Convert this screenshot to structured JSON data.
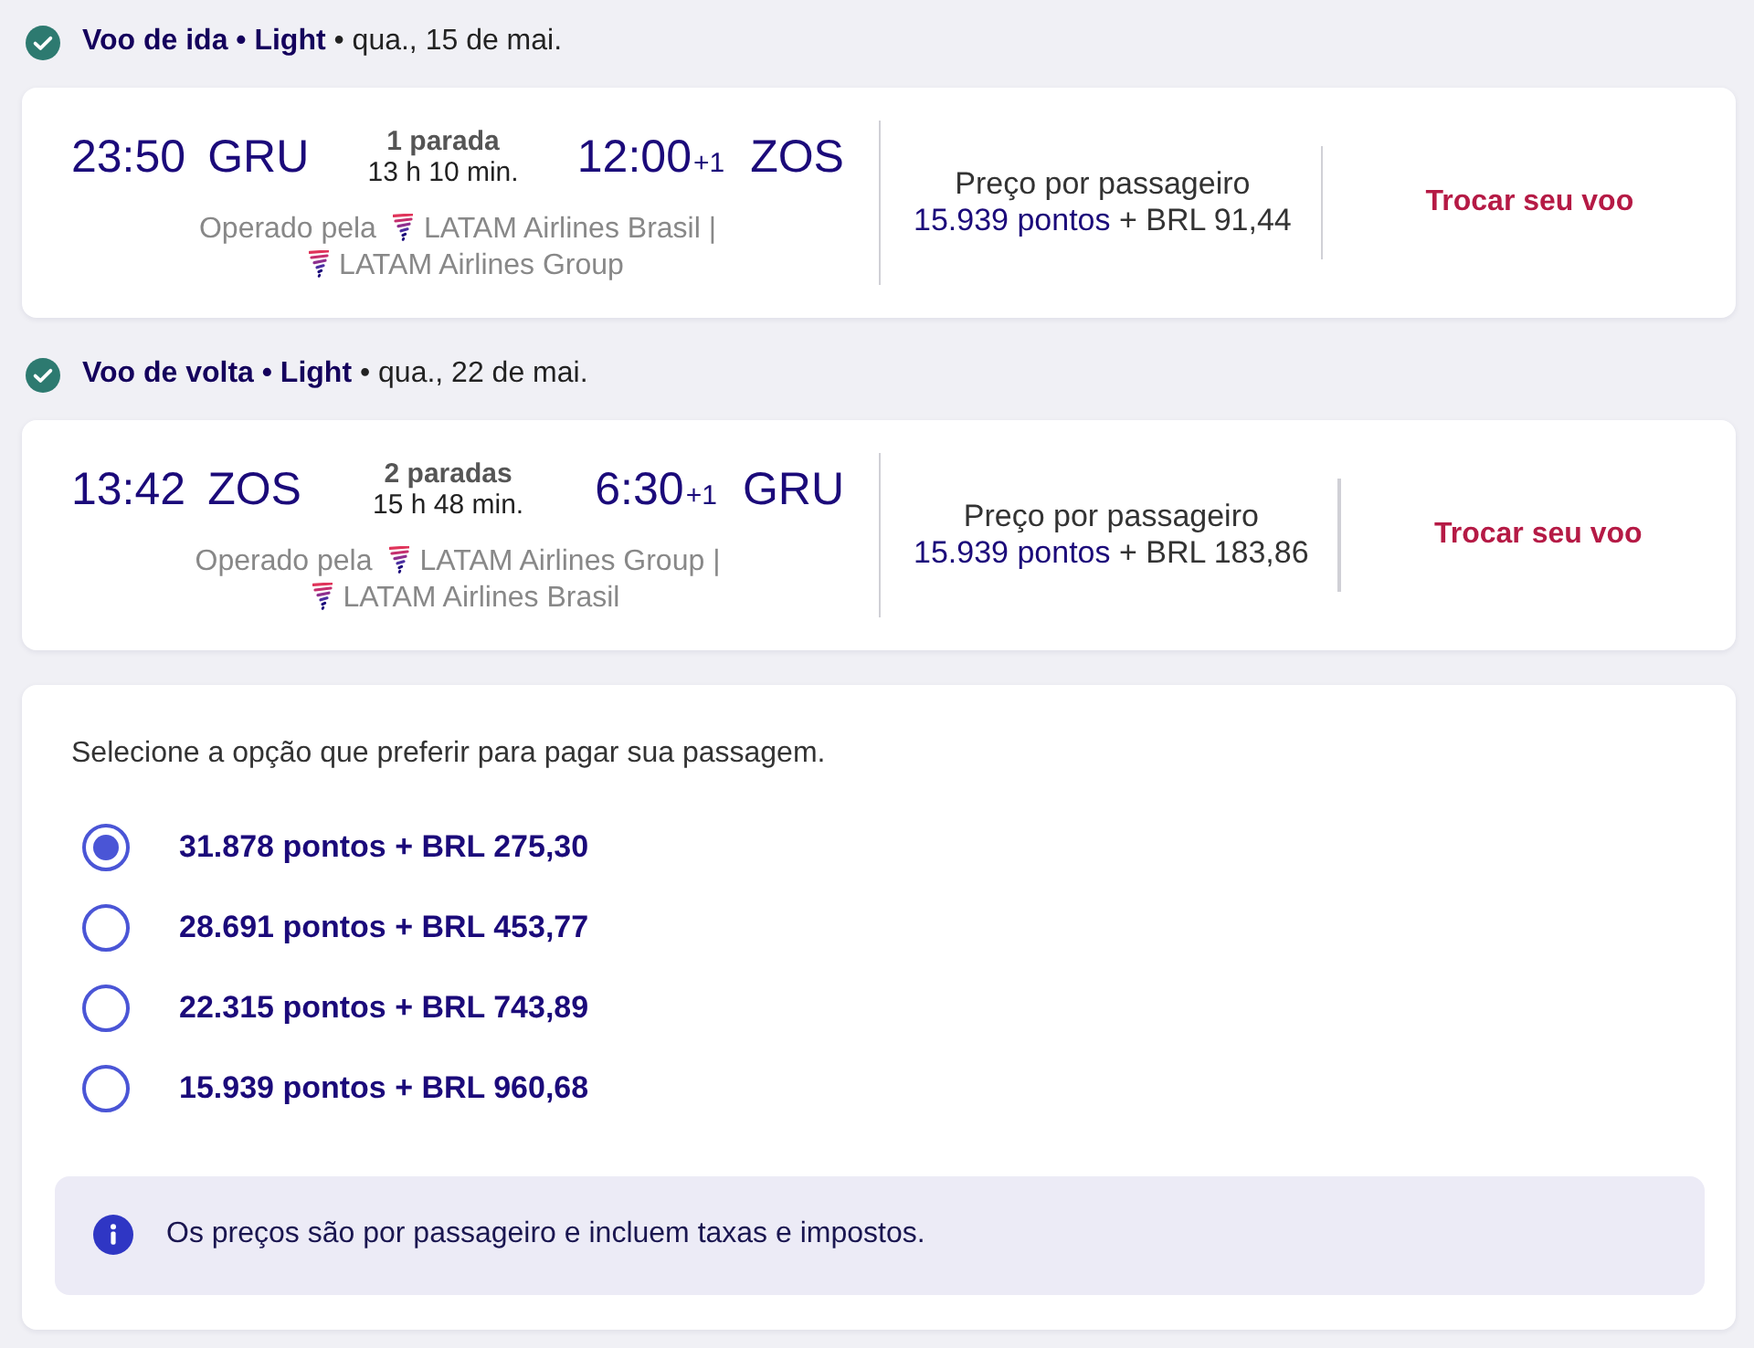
{
  "segments": [
    {
      "header": "**Voo de ida • Light** • qua., 15 de mai.",
      "departure": {
        "time": "23:50",
        "airport": "GRU"
      },
      "stops": "1 parada",
      "duration": "13 h 10 min.",
      "arrival": {
        "time": "12:00",
        "day_offset": "+1",
        "airport": "ZOS"
      },
      "operated_by": {
        "label": "Operado pela",
        "separator": "|",
        "carriers": [
          {
            "name": "LATAM Airlines Brasil"
          },
          {
            "name": "LATAM Airlines Group"
          }
        ]
      },
      "price": {
        "label": "Preço por passageiro",
        "points": "15.939 pontos",
        "cash": "+ BRL 91,44"
      },
      "change_button": "Trocar seu voo"
    },
    {
      "header": "**Voo de volta • Light** • qua., 22 de mai.",
      "departure": {
        "time": "13:42",
        "airport": "ZOS"
      },
      "stops": "2 paradas",
      "duration": "15 h 48 min.",
      "arrival": {
        "time": "6:30",
        "day_offset": "+1",
        "airport": "GRU"
      },
      "operated_by": {
        "label": "Operado pela",
        "separator": "|",
        "carriers": [
          {
            "name": "LATAM Airlines Group"
          },
          {
            "name": "LATAM Airlines Brasil"
          }
        ]
      },
      "price": {
        "label": "Preço por passageiro",
        "points": "15.939 pontos",
        "cash": "+ BRL 183,86"
      },
      "change_button": "Trocar seu voo"
    }
  ],
  "payment": {
    "prompt": "Selecione a opção que preferir para pagar sua passagem.",
    "options": [
      {
        "label": "31.878 pontos + BRL 275,30",
        "selected": true
      },
      {
        "label": "28.691 pontos + BRL 453,77",
        "selected": false
      },
      {
        "label": "22.315 pontos + BRL 743,89",
        "selected": false
      },
      {
        "label": "15.939 pontos + BRL 960,68",
        "selected": false
      }
    ],
    "note": "Os preços são por passageiro e incluem taxas e impostos."
  }
}
